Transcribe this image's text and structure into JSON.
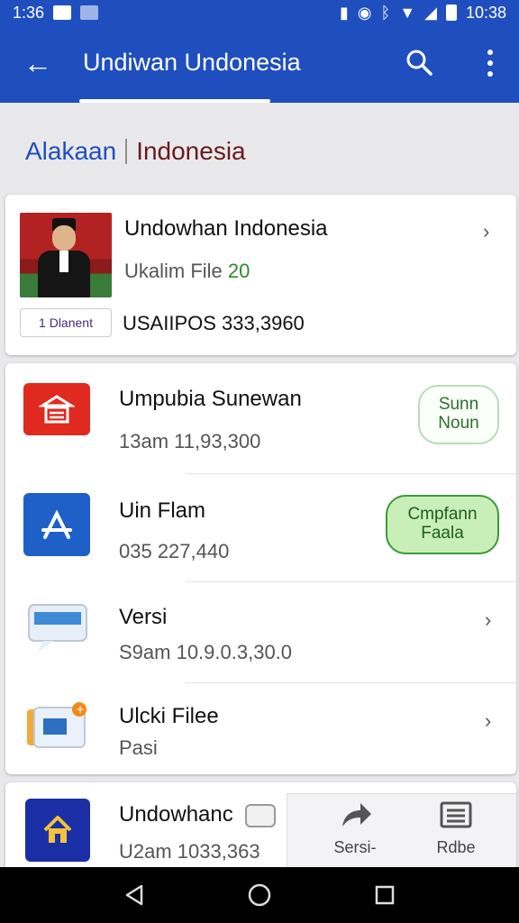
{
  "status_bar": {
    "time_left": "1:36",
    "time_right": "10:38"
  },
  "app_bar": {
    "title": "Undiwan Undonesia"
  },
  "section": {
    "label_a": "Alakaan",
    "label_b": "Indonesia"
  },
  "featured": {
    "title": "Undowhan Indonesia",
    "subtitle_text": "Ukalim File",
    "subtitle_num": "20",
    "chip": "1 Dlanent",
    "price": "USAIIPOS 333,3960"
  },
  "rows": [
    {
      "name": "Umpubia Sunewan",
      "meta": "13am  11,93,300",
      "pill": "Sunn Noun",
      "icon": "store-icon",
      "color": "#e02a20"
    },
    {
      "name": "Uin Flam",
      "meta": "035    227,440",
      "pill": "Cmpfann Faala",
      "icon": "app-store-icon",
      "color": "#1f5fc8"
    },
    {
      "name": "Versi",
      "meta": "S9am 10.9.0.3,30.0",
      "icon": "chat-bubble-icon"
    },
    {
      "name": "Ulcki Filee",
      "meta": "Pasi",
      "icon": "document-badge-icon"
    }
  ],
  "last_item": {
    "name": "Undowhanc",
    "meta": "U2am 1033,363",
    "icon": "home-icon"
  },
  "actions": {
    "share_label": "Sersi-",
    "rdbe_label": "Rdbe"
  },
  "colors": {
    "primary": "#1f4fbf",
    "green": "#2e8b2e"
  }
}
